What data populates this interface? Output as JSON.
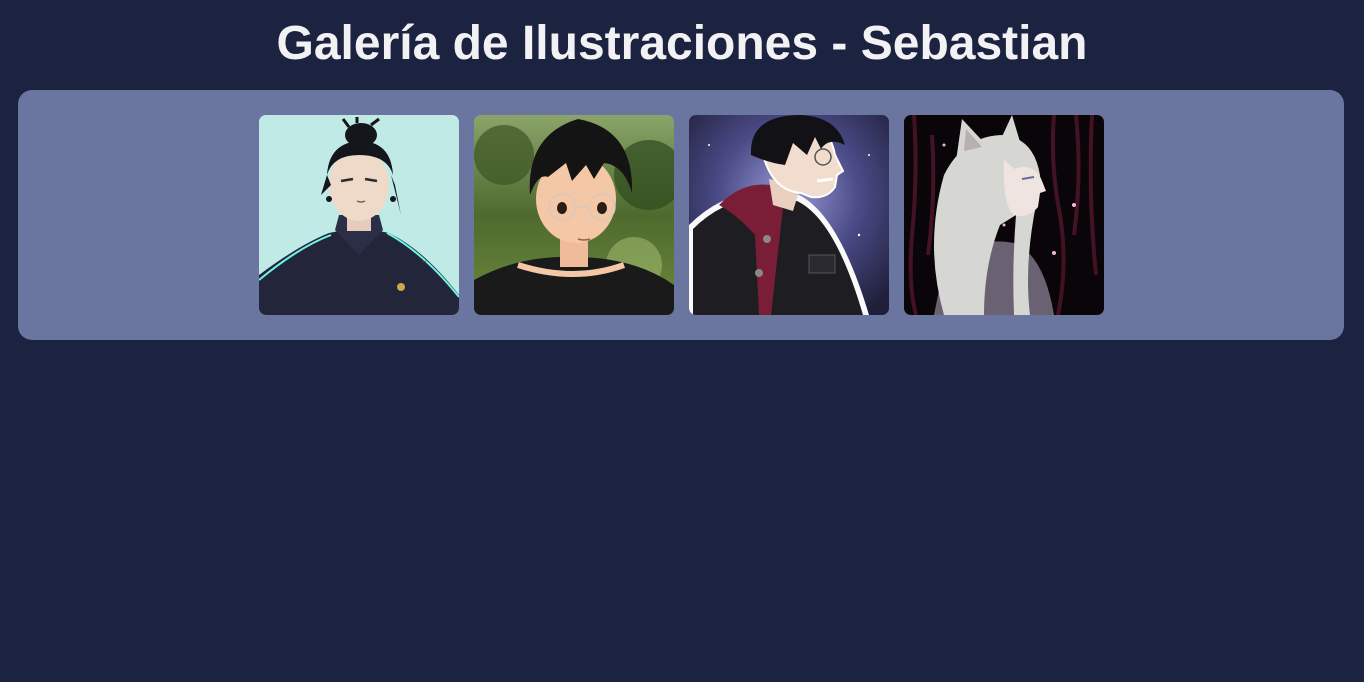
{
  "header": {
    "title": "Galería de Ilustraciones - Sebastian"
  },
  "gallery": {
    "items": [
      {
        "name": "illustration-1",
        "palette": {
          "bg": "#bfeae6",
          "hair": "#15161c",
          "skin": "#efd9c9",
          "clothes": "#23253a"
        }
      },
      {
        "name": "illustration-2",
        "palette": {
          "bg": "#5c7a3a",
          "hair": "#141414",
          "skin": "#f4c8a6",
          "clothes": "#1a1a1a"
        }
      },
      {
        "name": "illustration-3",
        "palette": {
          "bg": "#4a4a86",
          "hair": "#111116",
          "skin": "#f2dccd",
          "clothes": "#1d1d22"
        }
      },
      {
        "name": "illustration-4",
        "palette": {
          "bg": "#0a0508",
          "hair": "#d6d6d3",
          "skin": "#f0e4e0",
          "clothes": "#6a6272"
        }
      }
    ]
  }
}
